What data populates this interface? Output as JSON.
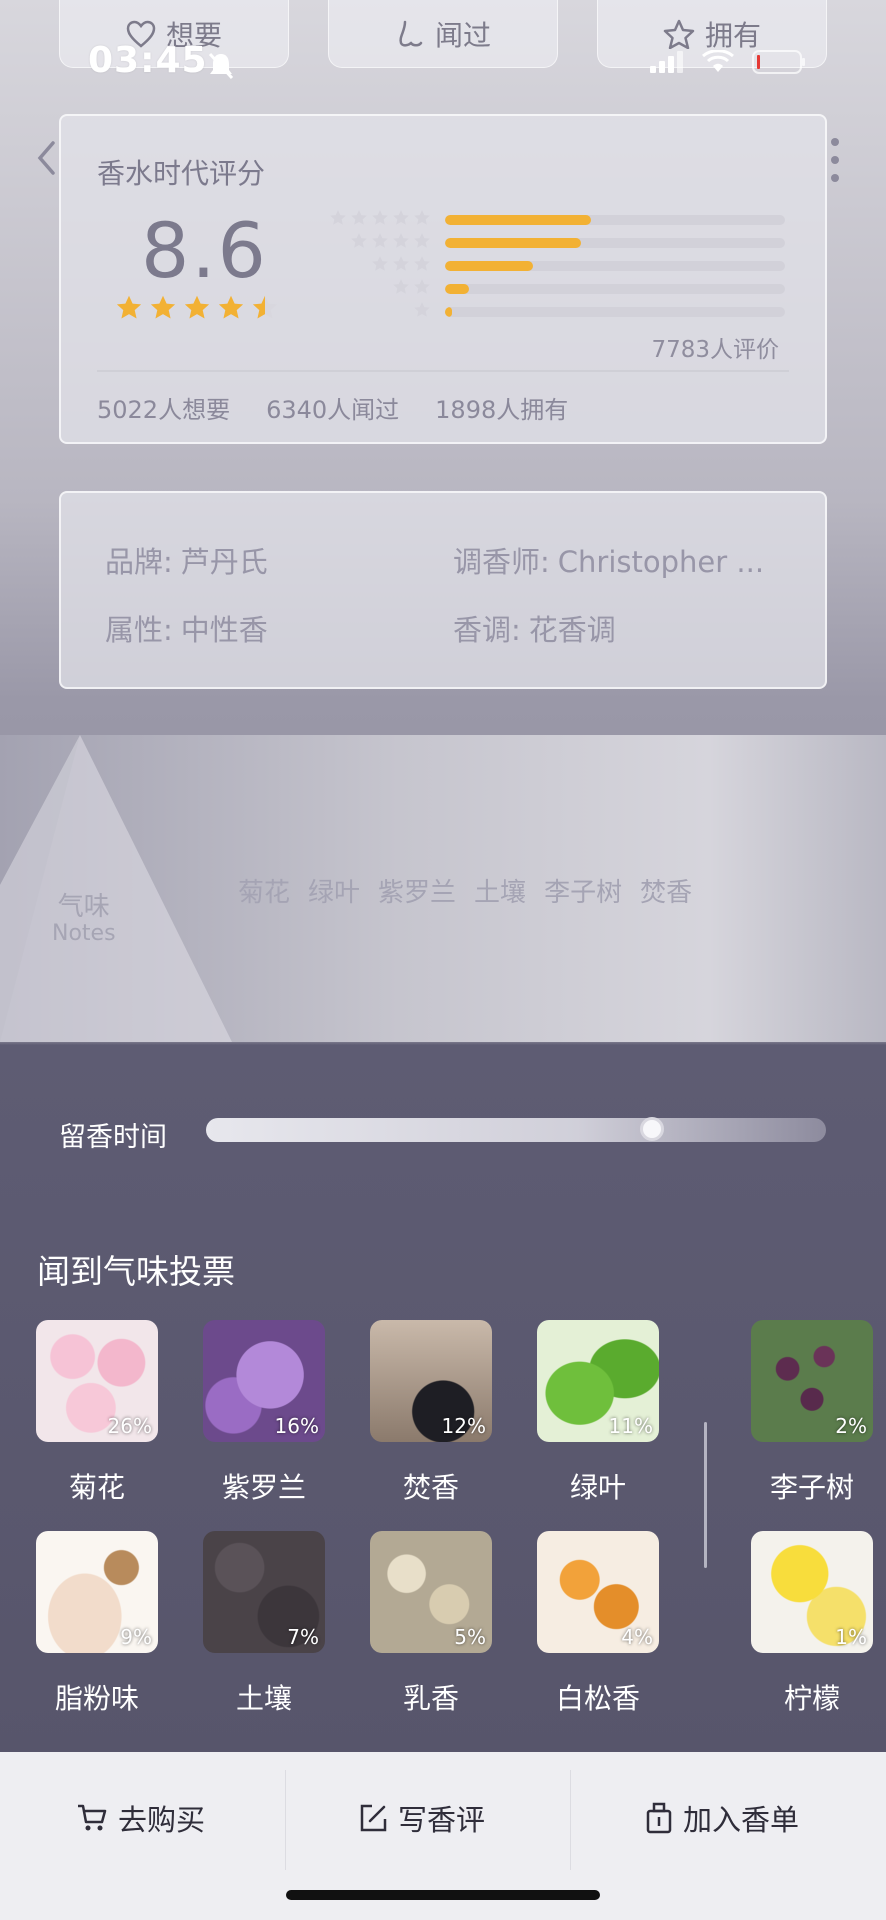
{
  "status_bar": {
    "time": "03:45"
  },
  "top_actions": [
    {
      "label": "想要",
      "icon": "heart-icon"
    },
    {
      "label": "闻过",
      "icon": "nose-icon"
    },
    {
      "label": "拥有",
      "icon": "star-icon"
    }
  ],
  "rating": {
    "title": "香水时代评分",
    "score": "8.6",
    "stars": 4.5,
    "count_label": "7783人评价",
    "distribution": [
      {
        "stars": 5,
        "fraction": 0.43
      },
      {
        "stars": 4,
        "fraction": 0.4
      },
      {
        "stars": 3,
        "fraction": 0.26
      },
      {
        "stars": 2,
        "fraction": 0.07
      },
      {
        "stars": 1,
        "fraction": 0.02
      }
    ],
    "stats": [
      "5022人想要",
      "6340人闻过",
      "1898人拥有"
    ]
  },
  "info": {
    "brand_key": "品牌:",
    "brand_value": "芦丹氏",
    "perfumer_key": "调香师:",
    "perfumer_value": "Christopher ...",
    "gender_key": "属性:",
    "gender_value": "中性香",
    "family_key": "香调:",
    "family_value": "花香调"
  },
  "notes": {
    "title": "气味",
    "subtitle": "Notes",
    "items": [
      "菊花",
      "绿叶",
      "紫罗兰",
      "土壤",
      "李子树",
      "焚香"
    ]
  },
  "longevity": {
    "label": "留香时间",
    "level": 0.72
  },
  "vote": {
    "title": "闻到气味投票",
    "row1": [
      {
        "name": "菊花",
        "pct": "26%"
      },
      {
        "name": "紫罗兰",
        "pct": "16%"
      },
      {
        "name": "焚香",
        "pct": "12%"
      },
      {
        "name": "绿叶",
        "pct": "11%"
      },
      {
        "name": "李子树",
        "pct": "2%"
      }
    ],
    "row2": [
      {
        "name": "脂粉味",
        "pct": "9%"
      },
      {
        "name": "土壤",
        "pct": "7%"
      },
      {
        "name": "乳香",
        "pct": "5%"
      },
      {
        "name": "白松香",
        "pct": "4%"
      },
      {
        "name": "柠檬",
        "pct": "1%"
      }
    ]
  },
  "bottom_bar": {
    "buy": "去购买",
    "review": "写香评",
    "add_list": "加入香单"
  },
  "colors": {
    "accent_star": "#f2b134",
    "dark_bg": "#57556b"
  }
}
